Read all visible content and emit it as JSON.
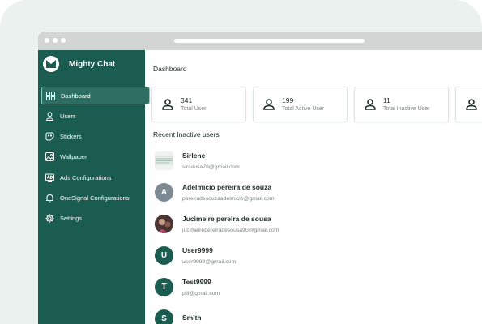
{
  "app": {
    "name": "Mighty Chat"
  },
  "sidebar": {
    "items": [
      {
        "label": "Dashboard",
        "icon": "dashboard-grid-icon",
        "active": true
      },
      {
        "label": "Users",
        "icon": "user-icon"
      },
      {
        "label": "Stickers",
        "icon": "sticker-icon"
      },
      {
        "label": "Wallpaper",
        "icon": "image-icon"
      },
      {
        "label": "Ads Configurations",
        "icon": "ad-icon"
      },
      {
        "label": "OneSignal Configurations",
        "icon": "bell-icon"
      },
      {
        "label": "Settings",
        "icon": "gear-icon"
      }
    ]
  },
  "main": {
    "title": "Dashboard",
    "stats": [
      {
        "value": "341",
        "label": "Total User"
      },
      {
        "value": "199",
        "label": "Total Active User"
      },
      {
        "value": "11",
        "label": "Total Inactive User"
      }
    ],
    "recent_title": "Recent Inactive users",
    "users": [
      {
        "name": "Sirlene",
        "email": "sirsousa76@gmail.com",
        "avatar": ""
      },
      {
        "name": "Adelmicio pereira de souza",
        "email": "pereiradesouzaadelmicio@gmail.com",
        "avatar": "A"
      },
      {
        "name": "Jucimeire pereira de sousa",
        "email": "jucimeirepereiradesousa90@gmail.com",
        "avatar": ""
      },
      {
        "name": "User9999",
        "email": "user9999@gmail.com",
        "avatar": "U"
      },
      {
        "name": "Test9999",
        "email": "pill@gmail.com",
        "avatar": "T"
      },
      {
        "name": "Smith",
        "email": "",
        "avatar": "S"
      }
    ]
  },
  "colors": {
    "sidebar": "#1a5c50",
    "accent": "#1a5c50",
    "backdrop": "#eaf1ee"
  }
}
